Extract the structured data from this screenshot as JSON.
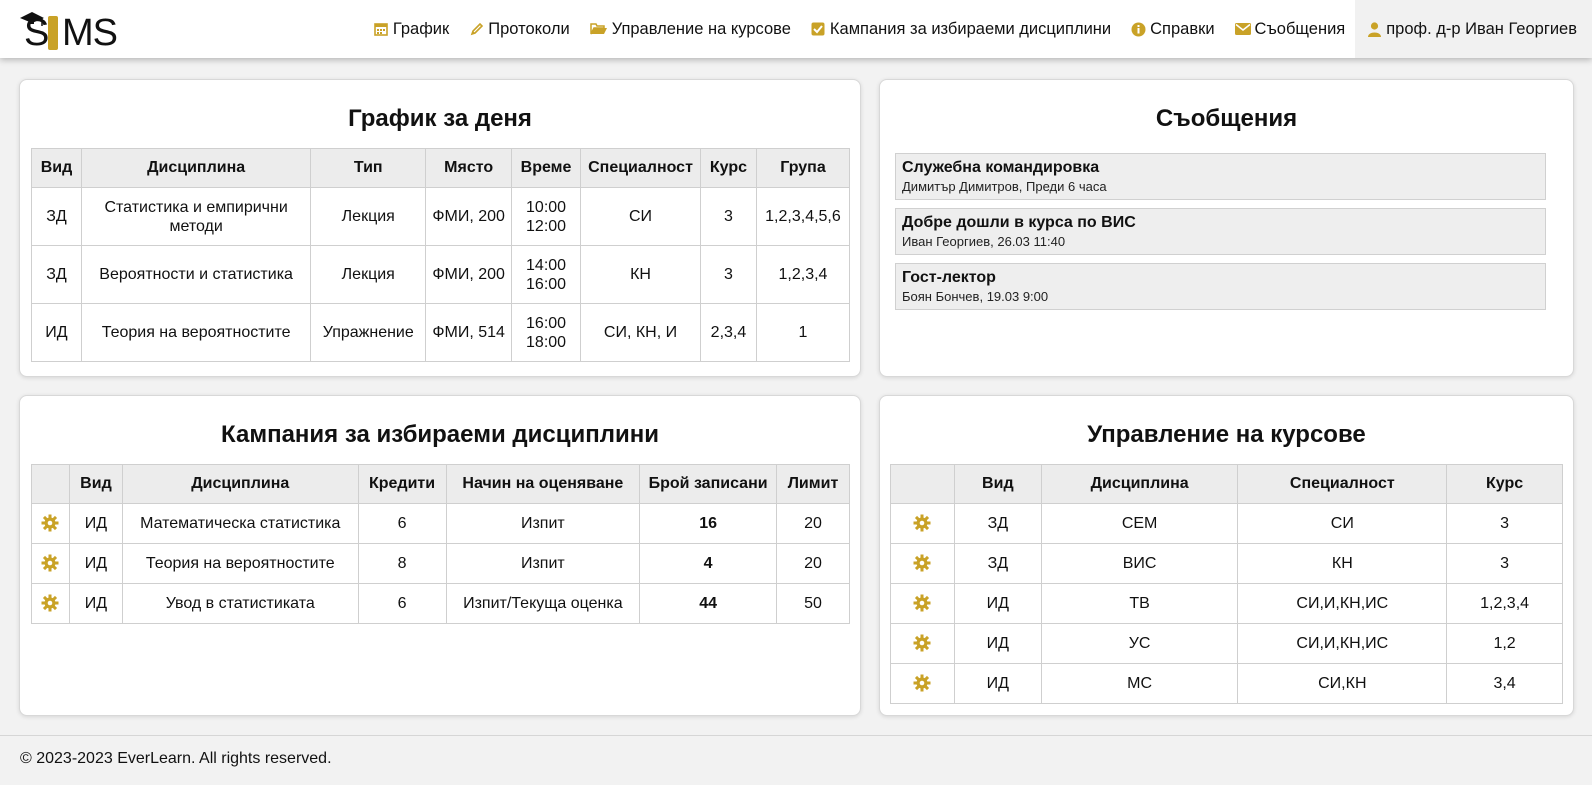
{
  "app": {
    "logo_text": "SIMS",
    "accent_color": "#c9a227"
  },
  "nav": {
    "items": [
      {
        "label": "График",
        "icon": "calendar-icon"
      },
      {
        "label": "Протоколи",
        "icon": "pencil-icon"
      },
      {
        "label": "Управление на курсове",
        "icon": "folder-open-icon"
      },
      {
        "label": "Кампания за избираеми дисциплини",
        "icon": "check-square-icon"
      },
      {
        "label": "Справки",
        "icon": "info-circle-icon"
      },
      {
        "label": "Съобщения",
        "icon": "envelope-icon"
      }
    ],
    "user": {
      "label": "проф. д-р Иван Георгиев",
      "icon": "user-icon"
    }
  },
  "schedule": {
    "title": "График за деня",
    "headers": [
      "Вид",
      "Дисциплина",
      "Тип",
      "Място",
      "Време",
      "Специалност",
      "Курс",
      "Група"
    ],
    "rows": [
      {
        "kind": "ЗД",
        "discipline": "Статистика и емпирични методи",
        "type": "Лекция",
        "place": "ФМИ, 200",
        "time_start": "10:00",
        "time_end": "12:00",
        "specialty": "СИ",
        "course": "3",
        "group": "1,2,3,4,5,6"
      },
      {
        "kind": "ЗД",
        "discipline": "Вероятности и статистика",
        "type": "Лекция",
        "place": "ФМИ, 200",
        "time_start": "14:00",
        "time_end": "16:00",
        "specialty": "КН",
        "course": "3",
        "group": "1,2,3,4"
      },
      {
        "kind": "ИД",
        "discipline": "Теория на вероятностите",
        "type": "Упражнение",
        "place": "ФМИ, 514",
        "time_start": "16:00",
        "time_end": "18:00",
        "specialty": "СИ, КН, И",
        "course": "2,3,4",
        "group": "1"
      }
    ]
  },
  "messages": {
    "title": "Съобщения",
    "items": [
      {
        "title": "Служебна командировка",
        "author": "Димитър Димитров",
        "when": "Преди 6 часа"
      },
      {
        "title": "Добре дошли в курса по ВИС",
        "author": "Иван Георгиев",
        "when": "26.03 11:40"
      },
      {
        "title": "Гост-лектор",
        "author": "Боян Бончев",
        "when": "19.03 9:00"
      }
    ]
  },
  "campaign": {
    "title": "Кампания за избираеми дисциплини",
    "headers": [
      "",
      "Вид",
      "Дисциплина",
      "Кредити",
      "Начин на оценяване",
      "Брой записани",
      "Лимит"
    ],
    "rows": [
      {
        "kind": "ИД",
        "discipline": "Математическа статистика",
        "credits": "6",
        "grading": "Изпит",
        "enrolled": "16",
        "limit": "20"
      },
      {
        "kind": "ИД",
        "discipline": "Теория на вероятностите",
        "credits": "8",
        "grading": "Изпит",
        "enrolled": "4",
        "limit": "20"
      },
      {
        "kind": "ИД",
        "discipline": "Увод в статистиката",
        "credits": "6",
        "grading": "Изпит/Текуща оценка",
        "enrolled": "44",
        "limit": "50"
      }
    ]
  },
  "courses": {
    "title": "Управление на курсове",
    "headers": [
      "",
      "Вид",
      "Дисциплина",
      "Специалност",
      "Курс"
    ],
    "rows": [
      {
        "kind": "ЗД",
        "discipline": "СЕМ",
        "specialty": "СИ",
        "course": "3"
      },
      {
        "kind": "ЗД",
        "discipline": "ВИС",
        "specialty": "КН",
        "course": "3"
      },
      {
        "kind": "ИД",
        "discipline": "ТВ",
        "specialty": "СИ,И,КН,ИС",
        "course": "1,2,3,4"
      },
      {
        "kind": "ИД",
        "discipline": "УС",
        "specialty": "СИ,И,КН,ИС",
        "course": "1,2"
      },
      {
        "kind": "ИД",
        "discipline": "МС",
        "specialty": "СИ,КН",
        "course": "3,4"
      }
    ]
  },
  "footer": {
    "text": "© 2023-2023 EverLearn. All rights reserved."
  }
}
